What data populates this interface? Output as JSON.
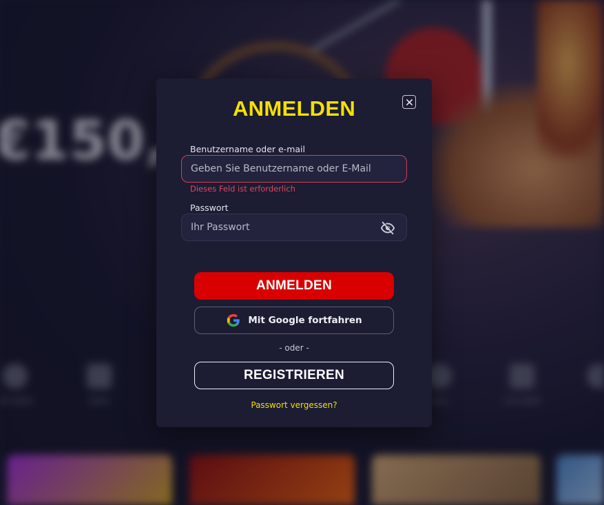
{
  "background": {
    "promo_amount": "€150,",
    "category_labels": [
      "Alle Spiele",
      "Spiele",
      "",
      "",
      "",
      "",
      "Slots",
      "Live Spiele",
      ""
    ]
  },
  "modal": {
    "title": "ANMELDEN",
    "close_icon": "close-icon",
    "username": {
      "label": "Benutzername oder e-mail",
      "placeholder": "Geben Sie Benutzername oder E-Mail",
      "value": "",
      "error": "Dieses Feld ist erforderlich"
    },
    "password": {
      "label": "Passwort",
      "placeholder": "Ihr Passwort",
      "value": "",
      "toggle_icon": "eye-off-icon"
    },
    "login_button": "ANMELDEN",
    "google_button": "Mit Google fortfahren",
    "google_icon": "google-icon",
    "separator": "- oder -",
    "register_button": "REGISTRIEREN",
    "forgot_link": "Passwort vergessen?"
  },
  "colors": {
    "accent_yellow": "#f4e100",
    "primary_red": "#d90000",
    "error_red": "#e04860",
    "modal_bg": "#1c1c33"
  }
}
